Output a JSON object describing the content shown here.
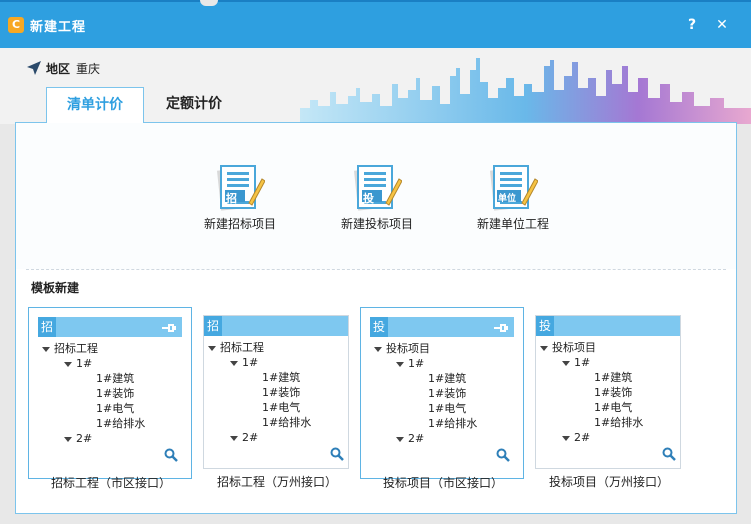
{
  "window": {
    "title": "新建工程",
    "logo_char": "C",
    "help_label": "?",
    "close_label": "✕"
  },
  "region": {
    "label": "地区",
    "value": "重庆"
  },
  "tabs": [
    {
      "label": "清单计价",
      "active": true
    },
    {
      "label": "定额计价",
      "active": false
    }
  ],
  "actions": [
    {
      "label": "新建招标项目",
      "doc_tag": "招"
    },
    {
      "label": "新建投标项目",
      "doc_tag": "投"
    },
    {
      "label": "新建单位工程",
      "doc_tag": "单位"
    }
  ],
  "templates": {
    "section_title": "模板新建",
    "cards": [
      {
        "tag": "招",
        "root": "招标工程",
        "b1": "1#",
        "items": [
          "1#建筑",
          "1#装饰",
          "1#电气",
          "1#给排水"
        ],
        "b2": "2#",
        "caption": "招标工程（市区接口）",
        "selected": true
      },
      {
        "tag": "招",
        "root": "招标工程",
        "b1": "1#",
        "items": [
          "1#建筑",
          "1#装饰",
          "1#电气",
          "1#给排水"
        ],
        "b2": "2#",
        "caption": "招标工程（万州接口）",
        "selected": false
      },
      {
        "tag": "投",
        "root": "投标项目",
        "b1": "1#",
        "items": [
          "1#建筑",
          "1#装饰",
          "1#电气",
          "1#给排水"
        ],
        "b2": "2#",
        "caption": "投标项目（市区接口）",
        "selected": true
      },
      {
        "tag": "投",
        "root": "投标项目",
        "b1": "1#",
        "items": [
          "1#建筑",
          "1#装饰",
          "1#电气",
          "1#给排水"
        ],
        "b2": "2#",
        "caption": "投标项目（万州接口）",
        "selected": false
      }
    ]
  },
  "colors": {
    "titlebar": "#2e9fe0",
    "accent": "#45a8e0",
    "card_header": "#7ec8f0"
  }
}
